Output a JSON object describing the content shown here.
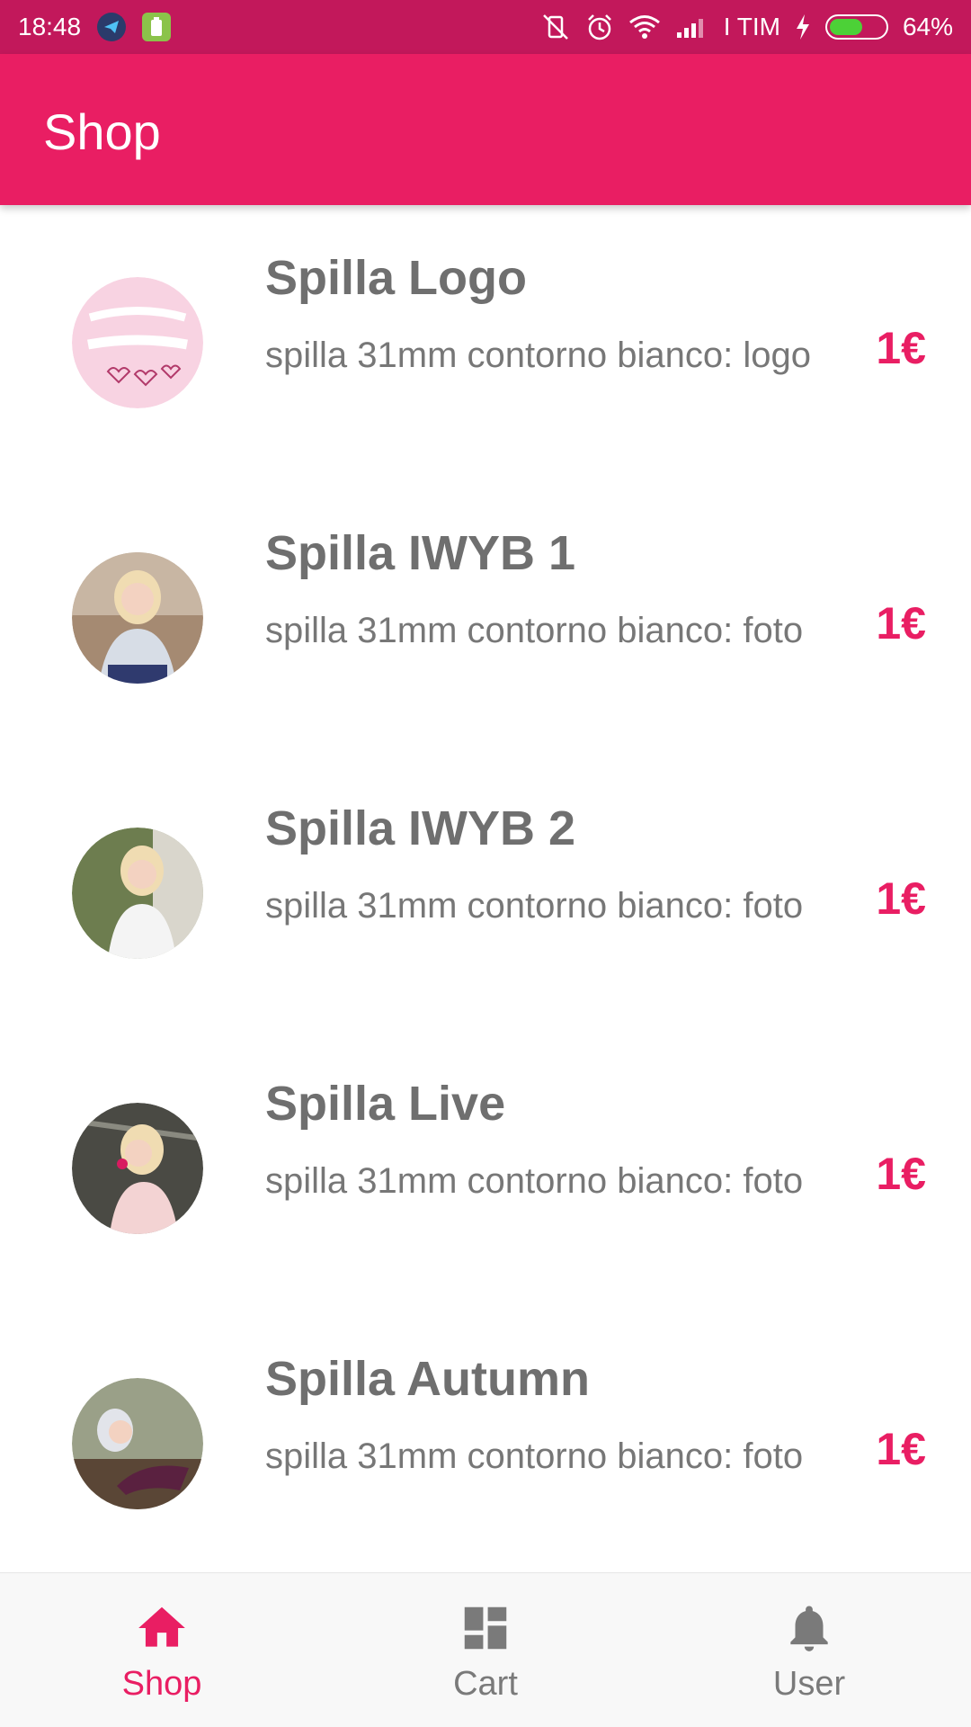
{
  "status_bar": {
    "time": "18:48",
    "carrier": "I TIM",
    "battery_text": "64%",
    "battery_level": 0.64,
    "icons": [
      "telegram-icon",
      "battery-saver-icon",
      "vibrate-off-icon",
      "alarm-icon",
      "wifi-icon",
      "signal-icon",
      "charging-icon",
      "battery-icon"
    ]
  },
  "app_bar": {
    "title": "Shop"
  },
  "colors": {
    "primary": "#e91e63",
    "primary_dark": "#c2185b",
    "text_gray": "#6f6f6f",
    "nav_inactive": "#7a7a7a"
  },
  "products": [
    {
      "title": "Spilla Logo",
      "description": "spilla 31mm contorno bianco: logo",
      "price": "1€",
      "image": "logo-thumbnail"
    },
    {
      "title": "Spilla IWYB 1",
      "description": "spilla 31mm contorno bianco: foto",
      "price": "1€",
      "image": "photo-thumbnail"
    },
    {
      "title": "Spilla IWYB 2",
      "description": "spilla 31mm contorno bianco: foto",
      "price": "1€",
      "image": "photo-thumbnail"
    },
    {
      "title": "Spilla Live",
      "description": "spilla 31mm contorno bianco: foto",
      "price": "1€",
      "image": "photo-thumbnail"
    },
    {
      "title": "Spilla Autumn",
      "description": "spilla 31mm contorno bianco: foto",
      "price": "1€",
      "image": "photo-thumbnail"
    }
  ],
  "bottom_nav": [
    {
      "label": "Shop",
      "icon": "home-icon",
      "active": true
    },
    {
      "label": "Cart",
      "icon": "dashboard-icon",
      "active": false
    },
    {
      "label": "User",
      "icon": "bell-icon",
      "active": false
    }
  ]
}
